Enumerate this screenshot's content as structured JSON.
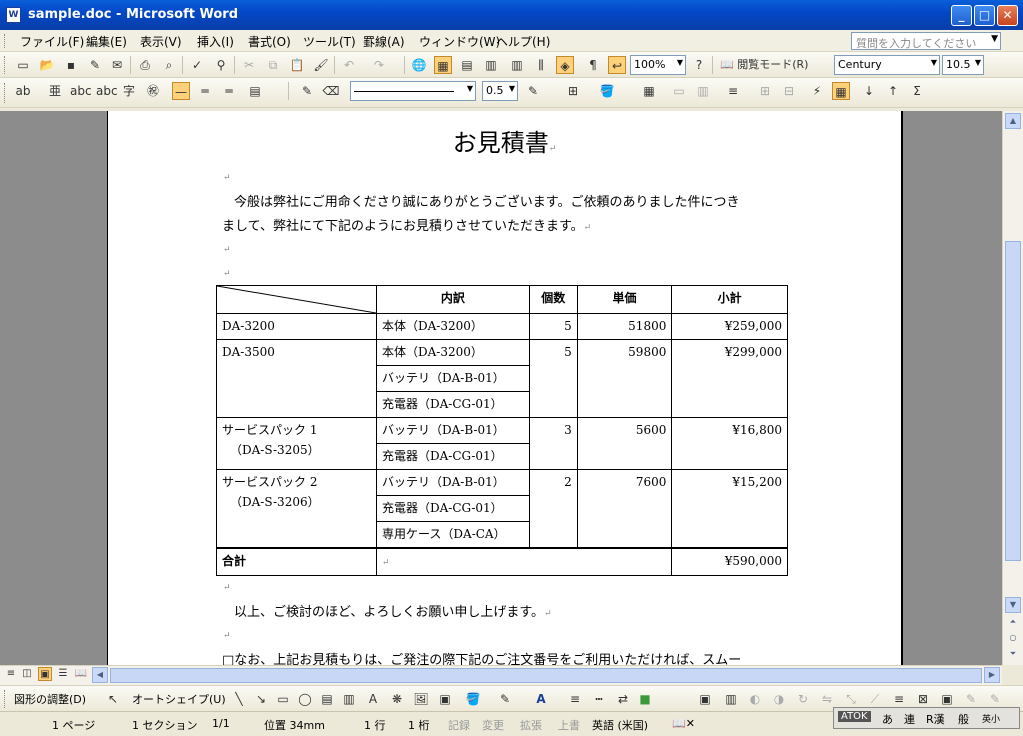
{
  "window": {
    "title": "sample.doc - Microsoft Word",
    "app_icon": "W"
  },
  "menu": {
    "items": [
      "ファイル(F)",
      "編集(E)",
      "表示(V)",
      "挿入(I)",
      "書式(O)",
      "ツール(T)",
      "罫線(A)",
      "ウィンドウ(W)",
      "ヘルプ(H)"
    ],
    "help_placeholder": "質問を入力してください"
  },
  "toolbar": {
    "zoom": "100%",
    "reading_mode": "閲覧モード(R)",
    "font": "Century",
    "font_size": "10.5",
    "line_weight": "0.5"
  },
  "document": {
    "title": "お見積書",
    "intro_line1": "今般は弊社にご用命くださり誠にありがとうございます。ご依頼のありました件につき",
    "intro_line2": "まして、弊社にて下記のようにお見積りさせていただきます。",
    "table": {
      "headers": [
        "",
        "内訳",
        "個数",
        "単価",
        "小計"
      ],
      "groups": [
        {
          "name": [
            "DA-3200"
          ],
          "items": [
            "本体（DA-3200）"
          ],
          "qty": "5",
          "price": "51800",
          "subtotal": "¥259,000"
        },
        {
          "name": [
            "DA-3500"
          ],
          "items": [
            "本体（DA-3200）",
            "バッテリ（DA-B-01）",
            "充電器（DA-CG-01）"
          ],
          "qty": "5",
          "price": "59800",
          "subtotal": "¥299,000"
        },
        {
          "name": [
            "サービスパック 1",
            "（DA-S-3205）"
          ],
          "items": [
            "バッテリ（DA-B-01）",
            "充電器（DA-CG-01）"
          ],
          "qty": "3",
          "price": "5600",
          "subtotal": "¥16,800"
        },
        {
          "name": [
            "サービスパック 2",
            "（DA-S-3206）"
          ],
          "items": [
            "バッテリ（DA-B-01）",
            "充電器（DA-CG-01）",
            "専用ケース（DA-CA）"
          ],
          "qty": "2",
          "price": "7600",
          "subtotal": "¥15,200"
        }
      ],
      "total_label": "合計",
      "total_value": "¥590,000"
    },
    "closing": "以上、ご検討のほど、よろしくお願い申し上げます。",
    "note": "□なお、上記お見積もりは、ご発注の際下記のご注文番号をご利用いただければ、スムー"
  },
  "drawing": {
    "adjust": "図形の調整(D)",
    "autoshape": "オートシェイプ(U)"
  },
  "status": {
    "page": "1 ページ",
    "section": "1 セクション",
    "pages": "1/1",
    "position": "位置 34mm",
    "line": "1 行",
    "column": "1 桁",
    "rec": "記録",
    "trk": "変更",
    "ext": "拡張",
    "ovr": "上書",
    "lang": "英語 (米国)"
  },
  "ime": {
    "name": "ATOK",
    "modes": [
      "あ",
      "連",
      "R漢",
      "般",
      "英小"
    ]
  }
}
